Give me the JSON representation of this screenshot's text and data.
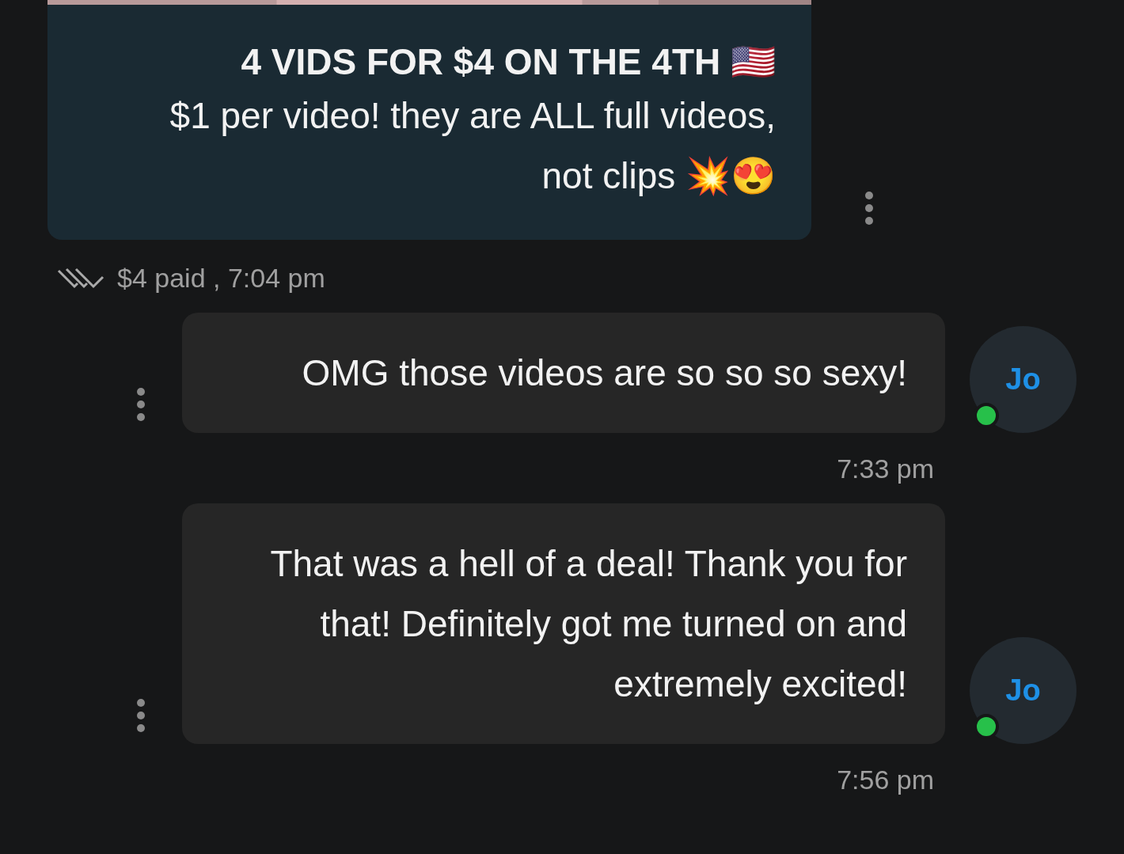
{
  "offer": {
    "title": "4 VIDS FOR $4 ON THE 4TH 🇺🇸",
    "body": "$1 per video! they are ALL full videos, not clips 💥😍",
    "meta": "$4 paid , 7:04 pm",
    "read": true
  },
  "messages": [
    {
      "avatar": "Jo",
      "online": true,
      "text": "OMG those videos are so so so sexy!",
      "time": "7:33 pm"
    },
    {
      "avatar": "Jo",
      "online": true,
      "text": "That was a hell of a deal! Thank you for that! Definitely got me turned on and extremely excited!",
      "time": "7:56 pm"
    }
  ]
}
